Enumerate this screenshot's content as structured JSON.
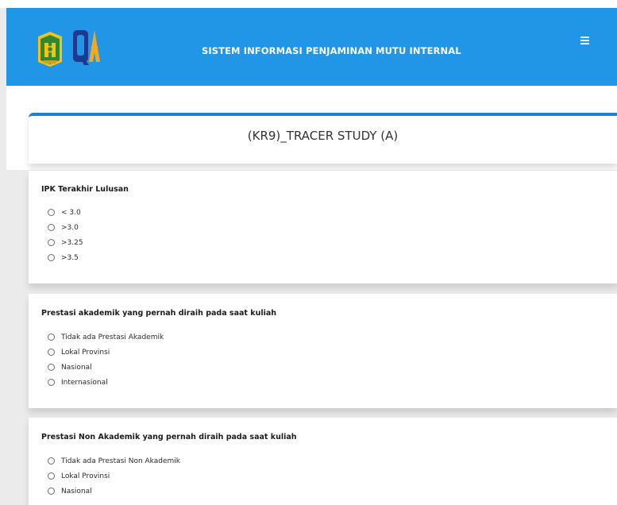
{
  "header": {
    "app_title": "SISTEM INFORMASI PENJAMINAN MUTU INTERNAL",
    "menu_icon": "hamburger-menu-icon",
    "bg_color": "#2196e6"
  },
  "form": {
    "title": "(KR9)_TRACER STUDY (A)",
    "accent_color": "#1f7fe0"
  },
  "questions": [
    {
      "title": "IPK Terakhir Lulusan",
      "options": [
        "< 3.0",
        ">3.0",
        ">3.25",
        ">3.5"
      ]
    },
    {
      "title": "Prestasi akademik yang pernah diraih pada saat kuliah",
      "options": [
        "Tidak ada Prestasi Akademik",
        "Lokal Provinsi",
        "Nasional",
        "Internasional"
      ]
    },
    {
      "title": "Prestasi Non Akademik yang pernah diraih pada saat kuliah",
      "options": [
        "Tidak ada Prestasi Non Akademik",
        "Lokal Provinsi",
        "Nasional"
      ]
    }
  ]
}
